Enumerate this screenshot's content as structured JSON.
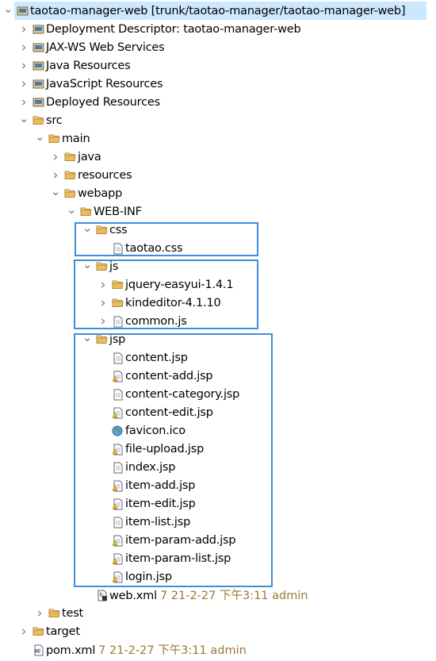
{
  "colors": {
    "selection": "#cce8ff",
    "highlight_box": "#3d8fdc",
    "decoration": "#9b7a34"
  },
  "tree": [
    {
      "label": "taotao-manager-web [trunk/taotao-manager/taotao-manager-web]",
      "level": 0,
      "state": "expanded",
      "icon": "web-project-icon",
      "selected": true
    },
    {
      "label": "Deployment Descriptor: taotao-manager-web",
      "level": 1,
      "state": "collapsed",
      "icon": "deployment-descriptor-icon"
    },
    {
      "label": "JAX-WS Web Services",
      "level": 1,
      "state": "collapsed",
      "icon": "web-services-icon"
    },
    {
      "label": "Java Resources",
      "level": 1,
      "state": "collapsed",
      "icon": "java-resources-icon"
    },
    {
      "label": "JavaScript Resources",
      "level": 1,
      "state": "collapsed",
      "icon": "javascript-resources-icon"
    },
    {
      "label": "Deployed Resources",
      "level": 1,
      "state": "collapsed",
      "icon": "deployed-resources-icon"
    },
    {
      "label": "src",
      "level": 1,
      "state": "expanded",
      "icon": "folder-icon"
    },
    {
      "label": "main",
      "level": 2,
      "state": "expanded",
      "icon": "folder-icon"
    },
    {
      "label": "java",
      "level": 3,
      "state": "collapsed",
      "icon": "folder-icon"
    },
    {
      "label": "resources",
      "level": 3,
      "state": "collapsed",
      "icon": "folder-icon"
    },
    {
      "label": "webapp",
      "level": 3,
      "state": "expanded",
      "icon": "folder-icon"
    },
    {
      "label": "WEB-INF",
      "level": 4,
      "state": "expanded",
      "icon": "folder-icon"
    },
    {
      "label": "css",
      "level": 5,
      "state": "expanded",
      "icon": "folder-icon"
    },
    {
      "label": "taotao.css",
      "level": 6,
      "state": "leaf",
      "icon": "file-icon"
    },
    {
      "label": "js",
      "level": 5,
      "state": "expanded",
      "icon": "folder-icon"
    },
    {
      "label": "jquery-easyui-1.4.1",
      "level": 6,
      "state": "collapsed",
      "icon": "folder-icon"
    },
    {
      "label": "kindeditor-4.1.10",
      "level": 6,
      "state": "collapsed",
      "icon": "folder-icon"
    },
    {
      "label": "common.js",
      "level": 6,
      "state": "collapsed",
      "icon": "js-file-icon"
    },
    {
      "label": "jsp",
      "level": 5,
      "state": "expanded",
      "icon": "folder-icon"
    },
    {
      "label": "content.jsp",
      "level": 6,
      "state": "leaf",
      "icon": "file-icon"
    },
    {
      "label": "content-add.jsp",
      "level": 6,
      "state": "leaf",
      "icon": "file-warning-icon"
    },
    {
      "label": "content-category.jsp",
      "level": 6,
      "state": "leaf",
      "icon": "file-icon"
    },
    {
      "label": "content-edit.jsp",
      "level": 6,
      "state": "leaf",
      "icon": "file-warning-icon"
    },
    {
      "label": "favicon.ico",
      "level": 6,
      "state": "leaf",
      "icon": "globe-icon"
    },
    {
      "label": "file-upload.jsp",
      "level": 6,
      "state": "leaf",
      "icon": "file-warning-icon"
    },
    {
      "label": "index.jsp",
      "level": 6,
      "state": "leaf",
      "icon": "file-icon"
    },
    {
      "label": "item-add.jsp",
      "level": 6,
      "state": "leaf",
      "icon": "file-warning-icon"
    },
    {
      "label": "item-edit.jsp",
      "level": 6,
      "state": "leaf",
      "icon": "file-warning-icon"
    },
    {
      "label": "item-list.jsp",
      "level": 6,
      "state": "leaf",
      "icon": "file-icon"
    },
    {
      "label": "item-param-add.jsp",
      "level": 6,
      "state": "leaf",
      "icon": "file-warning-icon"
    },
    {
      "label": "item-param-list.jsp",
      "level": 6,
      "state": "leaf",
      "icon": "file-warning-icon"
    },
    {
      "label": "login.jsp",
      "level": 6,
      "state": "leaf",
      "icon": "file-warning-icon"
    },
    {
      "label": "web.xml",
      "level": 5,
      "state": "leaf",
      "icon": "xml-file-icon",
      "decoration": "7  21-2-27 下午3:11  admin"
    },
    {
      "label": "test",
      "level": 2,
      "state": "collapsed",
      "icon": "folder-icon"
    },
    {
      "label": "target",
      "level": 1,
      "state": "collapsed",
      "icon": "folder-icon"
    },
    {
      "label": "pom.xml",
      "level": 1,
      "state": "leaf",
      "icon": "maven-file-icon",
      "decoration": "7  21-2-27 下午3:11  admin"
    }
  ]
}
